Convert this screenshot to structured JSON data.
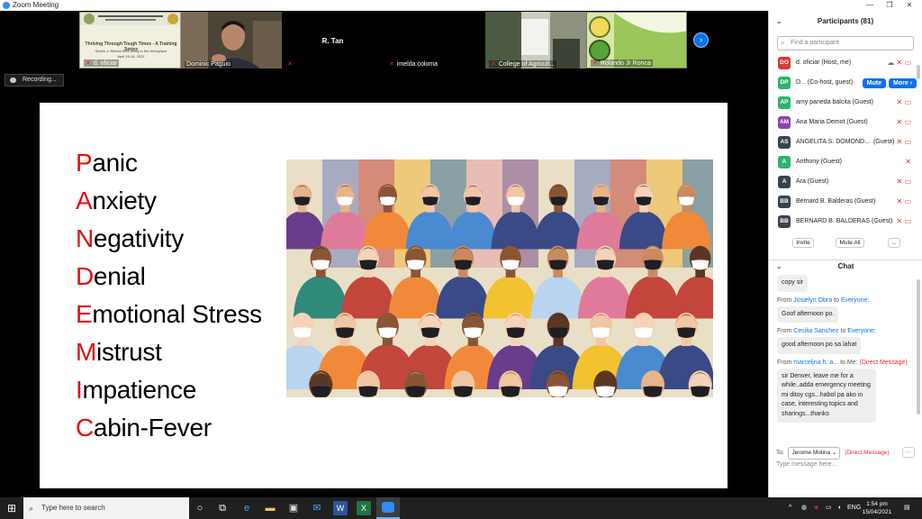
{
  "window": {
    "title": "Zoom Meeting",
    "minimize": "—",
    "maximize": "❐",
    "close": "✕"
  },
  "strip": {
    "thumbs": [
      {
        "name": "d. oficiar",
        "banner_title": "Thriving Through Tough Times - A Training Series",
        "banner_sub": "Series 1: Mental Well-being in the Workplace",
        "banner_date": "April 15-16, 2021"
      },
      {
        "name": "Dominic Paguio"
      },
      {
        "name": "R. Tan"
      },
      {
        "name": "imelda coloma"
      },
      {
        "name": "College of Agricult..."
      },
      {
        "name": "Rolando Jr Ronca"
      }
    ],
    "next_icon": "chevron-right-icon"
  },
  "recording": {
    "label": "Recording..."
  },
  "slide": {
    "lines": [
      {
        "first": "P",
        "rest": "anic"
      },
      {
        "first": "A",
        "rest": "nxiety"
      },
      {
        "first": "N",
        "rest": "egativity"
      },
      {
        "first": "D",
        "rest": "enial"
      },
      {
        "first": "E",
        "rest": "motional Stress"
      },
      {
        "first": "M",
        "rest": "istrust"
      },
      {
        "first": "I",
        "rest": "mpatience"
      },
      {
        "first": "C",
        "rest": "abin-Fever"
      }
    ],
    "accent": "#e01010"
  },
  "participants": {
    "header": "Participants (81)",
    "search_placeholder": "Find a participant",
    "mute_label": "Mute",
    "more_label": "More ›",
    "rows": [
      {
        "initials": "DO",
        "color": "#d63a3a",
        "name": "d. oficiar (Host, me)"
      },
      {
        "initials": "DP",
        "color": "#2fb36d",
        "name": "D... (Co-host, guest)"
      },
      {
        "initials": "AP",
        "color": "#2fb36d",
        "name": "amy paneda balcita (Guest)"
      },
      {
        "initials": "AM",
        "color": "#8e44ad",
        "name": "Ana Maria Demot (Guest)"
      },
      {
        "initials": "AS",
        "color": "#3a4250",
        "name": "ANGELITA S. DOMOND...",
        "role": "(Guest)"
      },
      {
        "initials": "A",
        "color": "#2fb36d",
        "name": "Anthony (Guest)"
      },
      {
        "initials": "A",
        "color": "#3a4250",
        "name": "Ara (Guest)"
      },
      {
        "initials": "BB",
        "color": "#3a4250",
        "name": "Bernard B. Balderas (Guest)"
      },
      {
        "initials": "BB",
        "color": "#3a4250",
        "name": "BERNARD B. BALDERAS (Guest)"
      }
    ],
    "invite_label": "Invite",
    "mute_all_label": "Mute All",
    "ellipsis_label": "..."
  },
  "chat": {
    "header": "Chat",
    "messages": [
      {
        "text": "copy sir"
      },
      {
        "from": "Josielyn Obra",
        "to": "Everyone",
        "text": "Goof afternoon po."
      },
      {
        "from": "Cecilia Sanchez",
        "to": "Everyone",
        "text": "good afternoon po sa lahat"
      },
      {
        "from": "marceljna h. a...",
        "to": "Me:",
        "dm": "(Direct Message)",
        "text": "sir Denver, leave me for a while..adda emergency meeting mi ditoy cgs...habol pa ako in case, interesting topics and sharings...thanks"
      }
    ],
    "from_word": "From",
    "to_word": "to",
    "to_label": "To:",
    "to_value": "Jerome Molina",
    "to_dm": "(Direct Message)",
    "input_placeholder": "Type message here..."
  },
  "taskbar": {
    "search_placeholder": "Type here to search",
    "lang": "ENG",
    "time": "1:54 pm",
    "date": "15/04/2021"
  }
}
